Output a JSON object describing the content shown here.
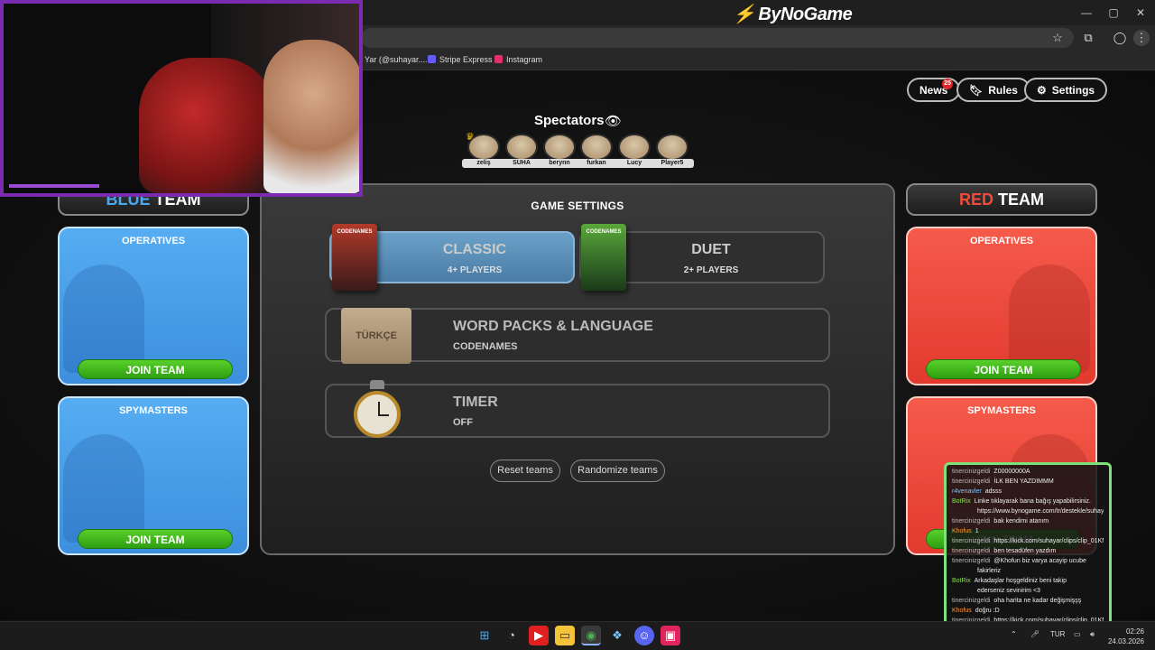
{
  "browser": {
    "brand": "ByNoGame",
    "bookmarks": [
      {
        "label": "Yar (@suhayar....",
        "color": "#333333"
      },
      {
        "label": "Stripe Express",
        "color": "#635bff"
      },
      {
        "label": "Instagram",
        "color": "#e1306c"
      }
    ],
    "window_controls": {
      "minimize": "—",
      "maximize": "▢",
      "close": "✕"
    }
  },
  "header": {
    "news_label": "News",
    "news_badge": "25",
    "rules_label": "Rules",
    "settings_label": "Settings"
  },
  "spectators": {
    "title": "Spectators",
    "players": [
      "zeliş",
      "SUHA",
      "berynn",
      "furkan",
      "Lucy",
      "Player5"
    ]
  },
  "blue_team": {
    "title_accent": "BLUE",
    "title_rest": " TEAM",
    "operatives_label": "OPERATIVES",
    "spymasters_label": "SPYMASTERS",
    "join_label": "JOIN TEAM",
    "color": "#4aa8f0"
  },
  "red_team": {
    "title_accent": "RED",
    "title_rest": " TEAM",
    "operatives_label": "OPERATIVES",
    "spymasters_label": "SPYMASTERS",
    "join_label": "JOIN TEAM",
    "color": "#f04a3a"
  },
  "game_settings": {
    "title": "GAME SETTINGS",
    "modes": [
      {
        "title": "CLASSIC",
        "subtitle": "4+ PLAYERS",
        "selected": true,
        "box_label": "CODENAMES"
      },
      {
        "title": "DUET",
        "subtitle": "2+ PLAYERS",
        "selected": false,
        "box_label": "CODENAMES"
      }
    ],
    "word_packs": {
      "title": "WORD PACKS & LANGUAGE",
      "subtitle": "CODENAMES",
      "image_label": "TÜRKÇE"
    },
    "timer": {
      "title": "TIMER",
      "subtitle": "OFF"
    },
    "reset_label": "Reset teams",
    "randomize_label": "Randomize teams"
  },
  "chat": {
    "messages": [
      {
        "user": "tinercinizgeldi",
        "text": "Z00000000A",
        "color": "#bbbbbb"
      },
      {
        "user": "tinercinizgeldi",
        "text": "İLK BEN YAZDIMMM",
        "color": "#bbbbbb"
      },
      {
        "user": "r4venavler",
        "text": "adsss",
        "color": "#7ec8ff"
      },
      {
        "user": "BotRix",
        "text": "Linke tıklayarak bana bağış yapabilirsiniz.",
        "color": "#8ce05a"
      },
      {
        "user": "",
        "text": "https://www.bynogame.com/tr/destekle/suhayar",
        "color": "#bbbbbb"
      },
      {
        "user": "tinercinizgeldi",
        "text": "bak kendimi atanım",
        "color": "#bbbbbb"
      },
      {
        "user": "Khofus",
        "text": "1",
        "color": "#ff9a3c"
      },
      {
        "user": "tinercinizgeldi",
        "text": "https://kick.com/suhayar/clips/clip_01KM",
        "color": "#bbbbbb"
      },
      {
        "user": "tinercinizgeldi",
        "text": "ben tesadüfen yazdım",
        "color": "#bbbbbb"
      },
      {
        "user": "tinercinizgeldi",
        "text": "@Khofun biz varya acayip ucube",
        "color": "#bbbbbb"
      },
      {
        "user": "",
        "text": "fakirleriz",
        "color": "#bbbbbb"
      },
      {
        "user": "BotRix",
        "text": "Arkadaşlar hoşgeldiniz beni takip",
        "color": "#8ce05a"
      },
      {
        "user": "",
        "text": "ederseniz sevinirim <3",
        "color": "#bbbbbb"
      },
      {
        "user": "tinercinizgeldi",
        "text": "oha harita ne kadar değişmişşş",
        "color": "#bbbbbb"
      },
      {
        "user": "Khofus",
        "text": "doğru :D",
        "color": "#ff9a3c"
      },
      {
        "user": "tinercinizgeldi",
        "text": "https://kick.com/suhayar/clips/clip_01KM",
        "color": "#bbbbbb"
      }
    ]
  },
  "taskbar": {
    "language": "TUR",
    "time": "02:26",
    "date": "24.03.2026"
  }
}
